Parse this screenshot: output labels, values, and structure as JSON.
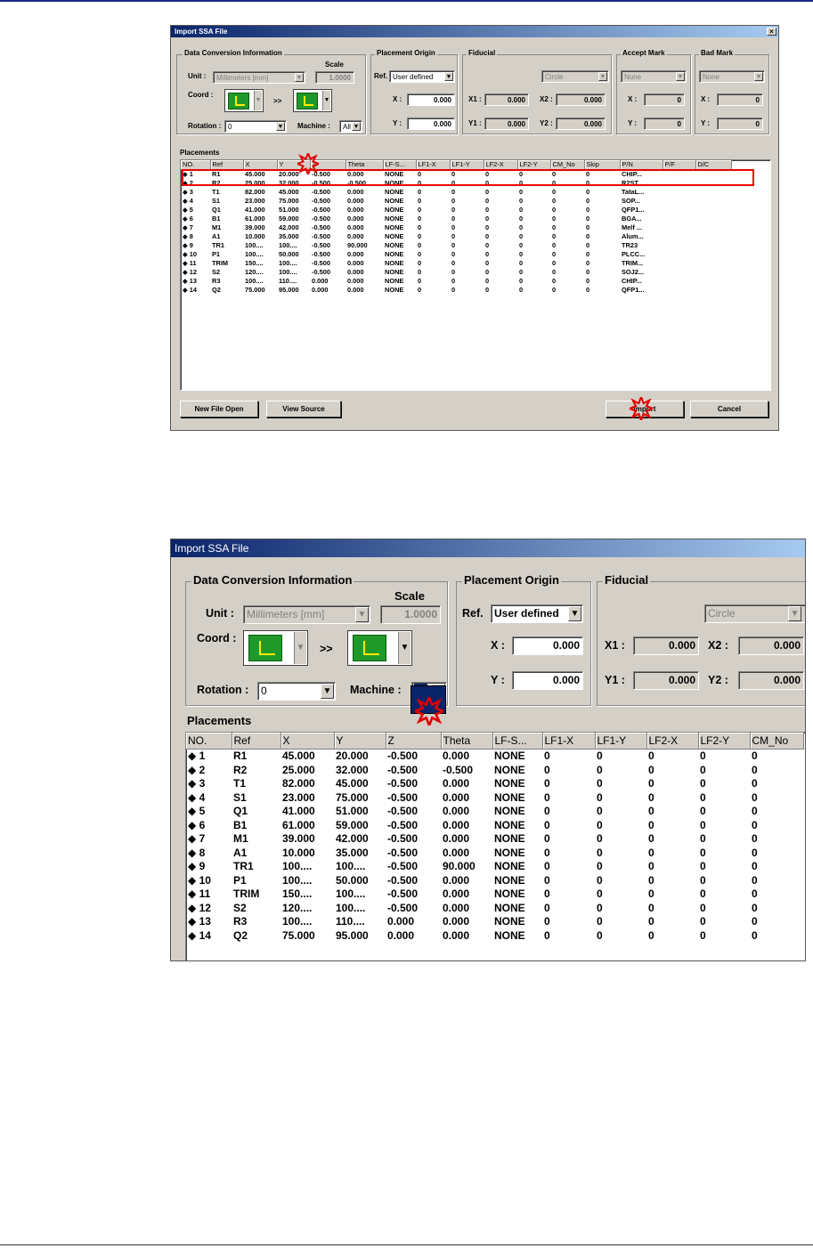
{
  "dialog": {
    "title": "Import SSA File",
    "close_glyph": "×",
    "data_conversion": {
      "label": "Data Conversion Information",
      "unit_label": "Unit :",
      "unit_value": "Millimeters [mm]",
      "scale_label": "Scale",
      "scale_value": "1.0000",
      "coord_label": "Coord :",
      "coord_sep": ">>",
      "rotation_label": "Rotation :",
      "rotation_value": "0",
      "machine_label": "Machine :",
      "machine_value": "All"
    },
    "placement_origin": {
      "label": "Placement Origin",
      "ref_label": "Ref.",
      "ref_value": "User defined",
      "x_label": "X :",
      "x_value": "0.000",
      "y_label": "Y :",
      "y_value": "0.000"
    },
    "fiducial": {
      "label": "Fiducial",
      "shape_value": "Circle",
      "x1_label": "X1 :",
      "x1_value": "0.000",
      "x2_label": "X2 :",
      "x2_value": "0.000",
      "y1_label": "Y1 :",
      "y1_value": "0.000",
      "y2_label": "Y2 :",
      "y2_value": "0.000"
    },
    "accept_mark": {
      "label": "Accept Mark",
      "value": "None",
      "x_label": "X :",
      "x_value": "0",
      "y_label": "Y :",
      "y_value": "0"
    },
    "bad_mark": {
      "label": "Bad Mark",
      "value": "None",
      "x_label": "X :",
      "x_value": "0",
      "y_label": "Y :",
      "y_value": "0"
    },
    "placements": {
      "label": "Placements",
      "columns": [
        "NO.",
        "Ref",
        "X",
        "Y",
        "Z",
        "Theta",
        "LF-S...",
        "LF1-X",
        "LF1-Y",
        "LF2-X",
        "LF2-Y",
        "CM_No",
        "Skip",
        "P/N",
        "P/F",
        "D/C"
      ],
      "rows": [
        [
          "◆ 1",
          "R1",
          "45.000",
          "20.000",
          "-0.500",
          "0.000",
          "NONE",
          "0",
          "0",
          "0",
          "0",
          "0",
          "0",
          "CHIP..."
        ],
        [
          "◆ 2",
          "R2",
          "25.000",
          "32.000",
          "-0.500",
          "-0.500",
          "NONE",
          "0",
          "0",
          "0",
          "0",
          "0",
          "0",
          "R2ST..."
        ],
        [
          "◆ 3",
          "T1",
          "82.000",
          "45.000",
          "-0.500",
          "0.000",
          "NONE",
          "0",
          "0",
          "0",
          "0",
          "0",
          "0",
          "TataL..."
        ],
        [
          "◆ 4",
          "S1",
          "23.000",
          "75.000",
          "-0.500",
          "0.000",
          "NONE",
          "0",
          "0",
          "0",
          "0",
          "0",
          "0",
          "SOP..."
        ],
        [
          "◆ 5",
          "Q1",
          "41.000",
          "51.000",
          "-0.500",
          "0.000",
          "NONE",
          "0",
          "0",
          "0",
          "0",
          "0",
          "0",
          "QFP1..."
        ],
        [
          "◆ 6",
          "B1",
          "61.000",
          "59.000",
          "-0.500",
          "0.000",
          "NONE",
          "0",
          "0",
          "0",
          "0",
          "0",
          "0",
          "BGA..."
        ],
        [
          "◆ 7",
          "M1",
          "39.000",
          "42.000",
          "-0.500",
          "0.000",
          "NONE",
          "0",
          "0",
          "0",
          "0",
          "0",
          "0",
          "Melf ..."
        ],
        [
          "◆ 8",
          "A1",
          "10.000",
          "35.000",
          "-0.500",
          "0.000",
          "NONE",
          "0",
          "0",
          "0",
          "0",
          "0",
          "0",
          "Alum..."
        ],
        [
          "◆ 9",
          "TR1",
          "100....",
          "100....",
          "-0.500",
          "90.000",
          "NONE",
          "0",
          "0",
          "0",
          "0",
          "0",
          "0",
          "TR23"
        ],
        [
          "◆ 10",
          "P1",
          "100....",
          "50.000",
          "-0.500",
          "0.000",
          "NONE",
          "0",
          "0",
          "0",
          "0",
          "0",
          "0",
          "PLCC..."
        ],
        [
          "◆ 11",
          "TRIM",
          "150....",
          "100....",
          "-0.500",
          "0.000",
          "NONE",
          "0",
          "0",
          "0",
          "0",
          "0",
          "0",
          "TRIM..."
        ],
        [
          "◆ 12",
          "S2",
          "120....",
          "100....",
          "-0.500",
          "0.000",
          "NONE",
          "0",
          "0",
          "0",
          "0",
          "0",
          "0",
          "SOJ2..."
        ],
        [
          "◆ 13",
          "R3",
          "100....",
          "110....",
          "0.000",
          "0.000",
          "NONE",
          "0",
          "0",
          "0",
          "0",
          "0",
          "0",
          "CHIP..."
        ],
        [
          "◆ 14",
          "Q2",
          "75.000",
          "95.000",
          "0.000",
          "0.000",
          "NONE",
          "0",
          "0",
          "0",
          "0",
          "0",
          "0",
          "QFP1..."
        ]
      ]
    },
    "buttons": {
      "new_file_open": "New File Open",
      "view_source": "View Source",
      "import": "Import",
      "cancel": "Cancel"
    }
  },
  "annotation_colors": {
    "marker": "#e00000",
    "highlight_box": "#e00000"
  }
}
